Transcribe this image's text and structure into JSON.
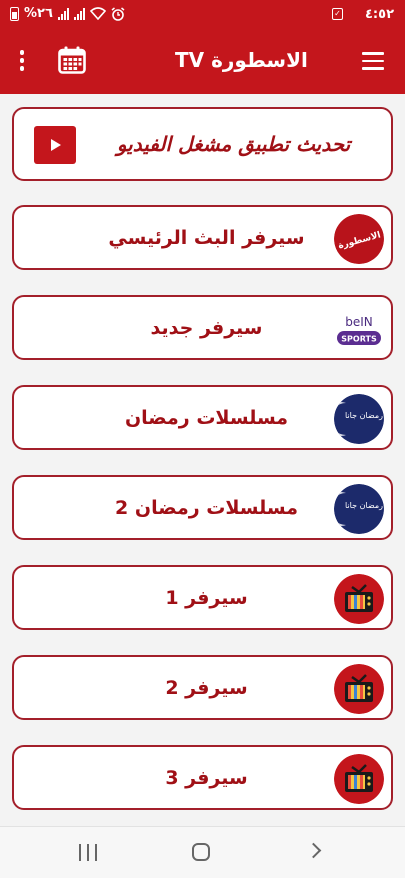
{
  "status_bar": {
    "time": "٤:٥٢",
    "battery_text": "%٢٦",
    "check_glyph": "✓"
  },
  "app_bar": {
    "title": "الاسطورة TV",
    "icons": [
      "menu-icon",
      "calendar-icon",
      "more-vert-icon"
    ]
  },
  "banner": {
    "label": "تحديث تطبيق مشغل الفيديو",
    "icon": "play-icon"
  },
  "items": [
    {
      "label": "سيرفر البث الرئيسي",
      "logo": "ostora-logo",
      "logo_text": "الاسطورة"
    },
    {
      "label": "سيرفر جديد",
      "logo": "bein-sports-logo",
      "logo_text": "beIN",
      "logo_subtext": "SPORTS"
    },
    {
      "label": "مسلسلات رمضان",
      "logo": "ramadan-logo",
      "logo_text": "رمضان جانا"
    },
    {
      "label": "مسلسلات رمضان 2",
      "logo": "ramadan-logo",
      "logo_text": "رمضان جانا"
    },
    {
      "label": "سيرفر 1",
      "logo": "tv-icon"
    },
    {
      "label": "سيرفر 2",
      "logo": "tv-icon"
    },
    {
      "label": "سيرفر 3",
      "logo": "tv-icon"
    }
  ],
  "colors": {
    "primary": "#c4161c",
    "card_border": "#a31f2a",
    "label": "#a01016",
    "background": "#f3f3f3"
  }
}
